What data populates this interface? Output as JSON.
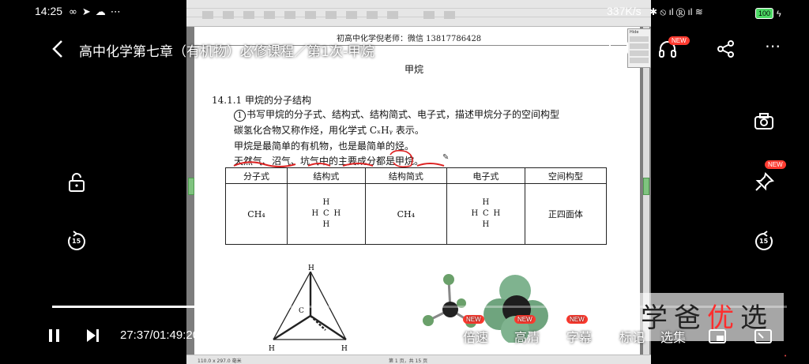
{
  "status_bar": {
    "time": "14:25",
    "speed": "337K/s",
    "battery": "100"
  },
  "video_title": "高中化学第七章（有机物）必修课程／第1次-甲烷",
  "document": {
    "header": "初高中化学倪老师：微信 13817786428",
    "title": "甲烷",
    "section": "14.1.1  甲烷的分子结构",
    "item_number": "1",
    "lines": [
      "书写甲烷的分子式、结构式、结构简式、电子式，描述甲烷分子的空间构型",
      "碳氢化合物又称作烃，用化学式 CₓHᵧ 表示。",
      "甲烷是最简单的有机物，也是最简单的烃。",
      "天然气、沼气、坑气中的主要成分都是甲烷。"
    ],
    "table": {
      "headers": [
        "分子式",
        "结构式",
        "结构简式",
        "电子式",
        "空间构型"
      ],
      "formula": "CH₄",
      "simple_formula": "CH₄",
      "geometry": "正四面体",
      "structural": [
        "",
        "H",
        "",
        "H",
        "C",
        "H",
        "",
        "H",
        ""
      ],
      "electron": [
        "",
        "H",
        "",
        "H",
        "C",
        "H",
        "",
        "H",
        ""
      ]
    },
    "tetra_labels": {
      "top": "H",
      "center": "C",
      "bottom_left": "H",
      "bottom_right": "H"
    },
    "side_widget_label": "Hide"
  },
  "sw_status": {
    "zoom": "110.0 x 297.0 毫米",
    "pager": "第 1 页，共 15 页"
  },
  "player": {
    "time": "27:37/01:49:20",
    "progress": 0.253,
    "menu": [
      {
        "label": "倍速",
        "new": "NEW"
      },
      {
        "label": "高清",
        "new": "NEW"
      },
      {
        "label": "字幕",
        "new": "NEW"
      },
      {
        "label": "标记",
        "new": ""
      },
      {
        "label": "选集",
        "new": ""
      }
    ],
    "seek_seconds": "15",
    "new_badge": "NEW"
  },
  "watermark": {
    "chars": [
      "学",
      "爸",
      "优",
      "选"
    ]
  },
  "colors": {
    "accent": "#ff3b30",
    "progress": "#ffffff"
  }
}
